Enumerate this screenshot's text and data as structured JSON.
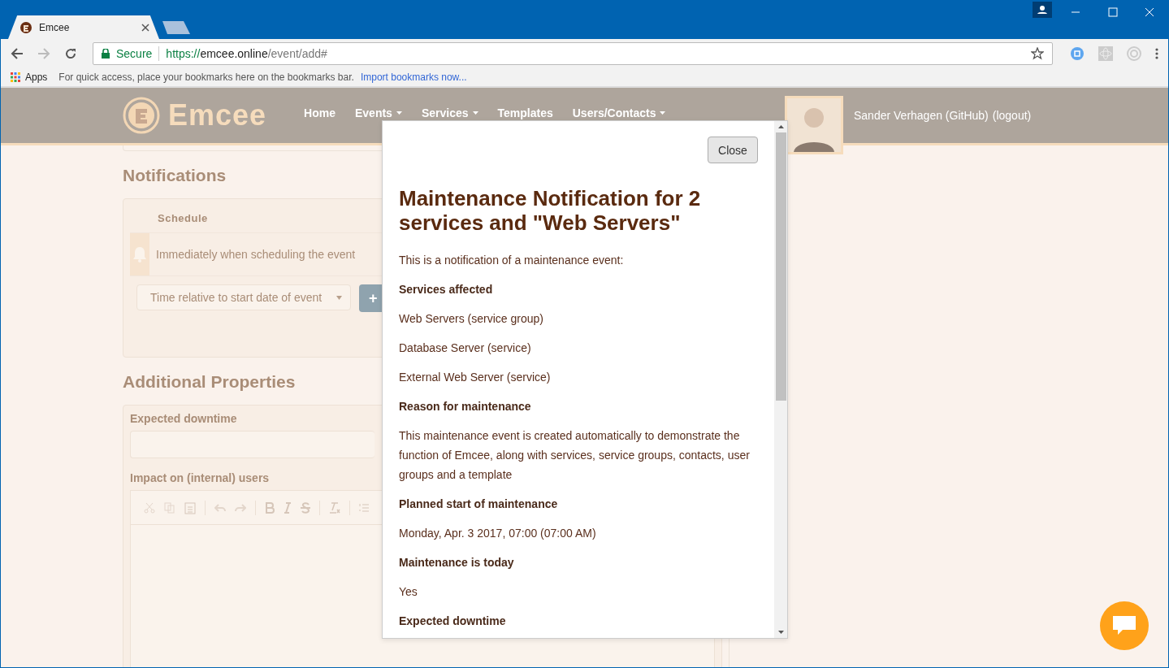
{
  "browser": {
    "tabs": [
      {
        "label": "Emcee",
        "selected": true
      }
    ],
    "secure_label": "Secure",
    "url_scheme": "https://",
    "url_host": "emcee.online",
    "url_path": "/event/add#",
    "bookmarks": {
      "apps": "Apps",
      "hint": "For quick access, place your bookmarks here on the bookmarks bar.",
      "import_link": "Import bookmarks now..."
    }
  },
  "site": {
    "brand": "Emcee",
    "nav": [
      {
        "label": "Home",
        "has_menu": false
      },
      {
        "label": "Events",
        "has_menu": true
      },
      {
        "label": "Services",
        "has_menu": true
      },
      {
        "label": "Templates",
        "has_menu": false
      },
      {
        "label": "Users/Contacts",
        "has_menu": true
      }
    ],
    "user_name": "Sander Verhagen (GitHub)",
    "logout": "(logout)"
  },
  "form": {
    "notifications_heading": "Notifications",
    "schedule_header": "Schedule",
    "schedule_rows": [
      "Immediately when scheduling the event"
    ],
    "time_select": {
      "placeholder": "Time relative to start date of event"
    },
    "add_button": "+",
    "additional_heading": "Additional Properties",
    "downtime_label": "Expected downtime",
    "impact_label": "Impact on (internal) users"
  },
  "modal": {
    "close": "Close",
    "title": "Maintenance Notification for 2 services and \"Web Servers\"",
    "body": [
      {
        "kind": "text",
        "text": "This is a notification of a maintenance event:"
      },
      {
        "kind": "heading",
        "text": "Services affected"
      },
      {
        "kind": "text",
        "text": "Web Servers (service group)"
      },
      {
        "kind": "text",
        "text": "Database Server (service)"
      },
      {
        "kind": "text",
        "text": "External Web Server (service)"
      },
      {
        "kind": "heading",
        "text": "Reason for maintenance"
      },
      {
        "kind": "text",
        "text": "This maintenance event is created automatically to demonstrate the function of Emcee, along with services, service groups, contacts, user groups and a template"
      },
      {
        "kind": "heading",
        "text": "Planned start of maintenance"
      },
      {
        "kind": "text",
        "text": "Monday, Apr. 3 2017, 07:00 (07:00 AM)"
      },
      {
        "kind": "heading",
        "text": "Maintenance is today"
      },
      {
        "kind": "text",
        "text": "Yes"
      },
      {
        "kind": "heading",
        "text": "Expected downtime"
      }
    ]
  }
}
